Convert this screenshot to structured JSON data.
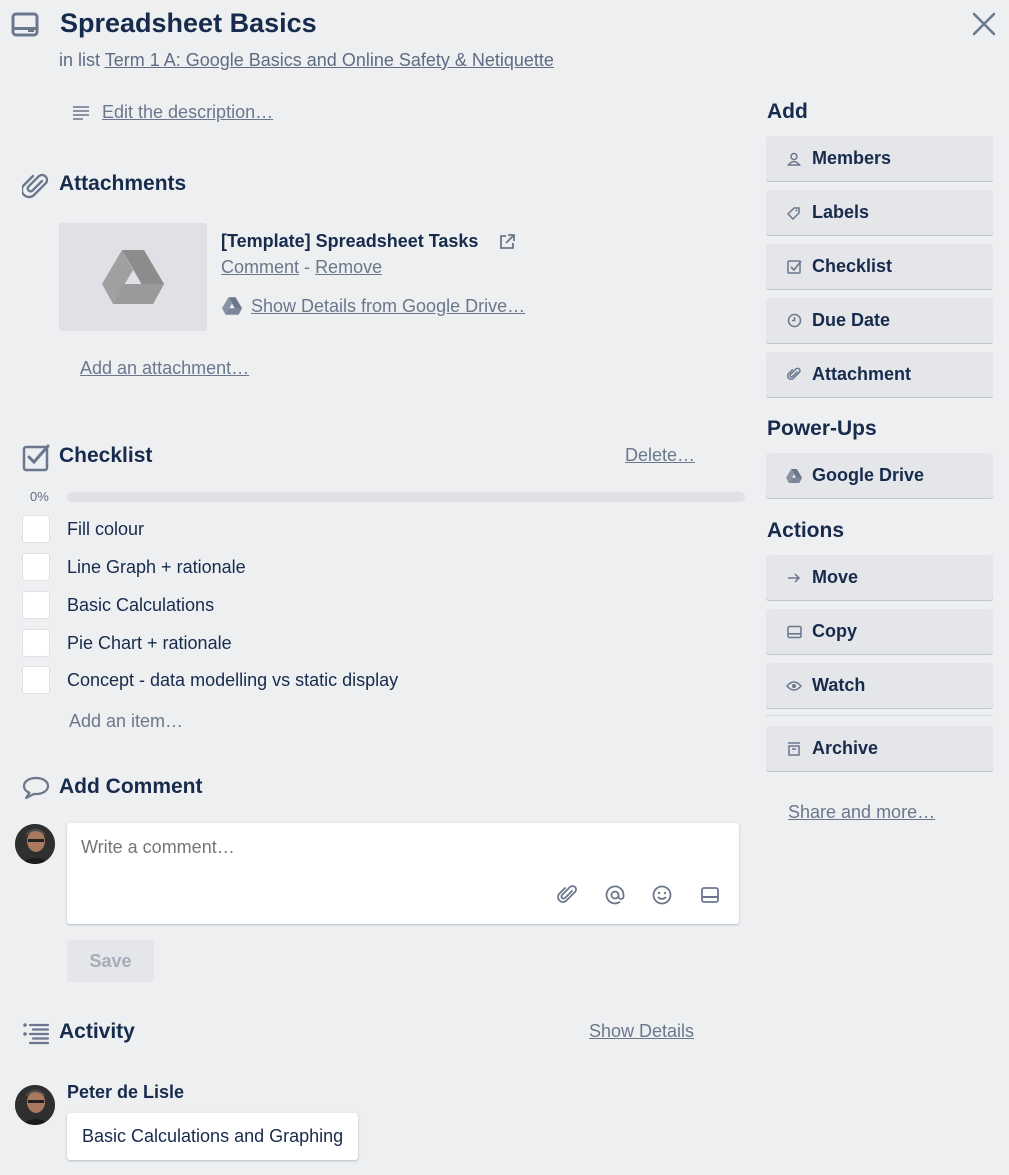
{
  "header": {
    "title": "Spreadsheet Basics",
    "in_list_prefix": "in list",
    "list_name": "Term 1 A: Google Basics and Online Safety & Netiquette"
  },
  "description": {
    "edit_label": "Edit the description…"
  },
  "attachments": {
    "title": "Attachments",
    "items": [
      {
        "name": "[Template] Spreadsheet Tasks",
        "comment_label": "Comment",
        "separator": "-",
        "remove_label": "Remove",
        "drive_details_label": "Show Details from Google Drive…"
      }
    ],
    "add_label": "Add an attachment…"
  },
  "checklist": {
    "title": "Checklist",
    "delete_label": "Delete…",
    "progress_label": "0%",
    "progress": 0,
    "items": [
      {
        "text": "Fill colour",
        "checked": false
      },
      {
        "text": "Line Graph + rationale",
        "checked": false
      },
      {
        "text": "Basic Calculations",
        "checked": false
      },
      {
        "text": "Pie Chart + rationale",
        "checked": false
      },
      {
        "text": "Concept - data modelling vs static display",
        "checked": false
      }
    ],
    "add_item_label": "Add an item…"
  },
  "comment": {
    "title": "Add Comment",
    "placeholder": "Write a comment…",
    "save_label": "Save",
    "tools": [
      "paperclip-icon",
      "at-mention-icon",
      "emoji-icon",
      "card-icon"
    ]
  },
  "activity": {
    "title": "Activity",
    "show_details_label": "Show Details",
    "entries": [
      {
        "user": "Peter de Lisle",
        "text": "Basic Calculations and Graphing"
      }
    ]
  },
  "sidebar": {
    "add_heading": "Add",
    "add_buttons": [
      {
        "label": "Members",
        "icon": "person-icon"
      },
      {
        "label": "Labels",
        "icon": "tag-icon"
      },
      {
        "label": "Checklist",
        "icon": "checkbox-icon"
      },
      {
        "label": "Due Date",
        "icon": "clock-icon"
      },
      {
        "label": "Attachment",
        "icon": "paperclip-icon"
      }
    ],
    "powerups_heading": "Power-Ups",
    "powerups_buttons": [
      {
        "label": "Google Drive",
        "icon": "google-drive-icon"
      }
    ],
    "actions_heading": "Actions",
    "action_buttons": [
      {
        "label": "Move",
        "icon": "arrow-right-icon"
      },
      {
        "label": "Copy",
        "icon": "card-icon"
      },
      {
        "label": "Watch",
        "icon": "eye-icon"
      }
    ],
    "archive_label": "Archive",
    "share_label": "Share and more…"
  },
  "colors": {
    "background": "#edeff1",
    "button": "#e4e6ea",
    "text": "#172b4d",
    "muted": "#6b778c"
  }
}
